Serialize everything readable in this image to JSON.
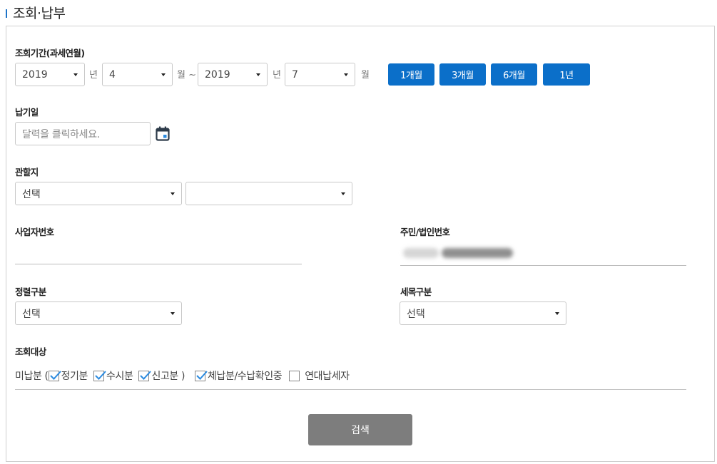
{
  "page": {
    "title": "조회·납부"
  },
  "period": {
    "label": "조회기간(과세연월)",
    "from_year": "2019",
    "year_unit": "년",
    "from_month": "4",
    "month_unit": "월 ~",
    "to_year": "2019",
    "to_month": "7",
    "to_month_unit": "월",
    "buttons": [
      "1개월",
      "3개월",
      "6개월",
      "1년"
    ]
  },
  "due_date": {
    "label": "납기일",
    "placeholder": "달력을 클릭하세요.",
    "icon": "calendar-icon"
  },
  "jurisdiction": {
    "label": "관할지",
    "first_value": "선택",
    "second_value": ""
  },
  "business_number": {
    "label": "사업자번호",
    "value": ""
  },
  "resident_number": {
    "label": "주민/법인번호"
  },
  "assessment_type": {
    "label": "정렬구분",
    "value": "선택"
  },
  "tax_item": {
    "label": "세목구분",
    "value": "선택"
  },
  "target": {
    "label": "조회대상",
    "prefix": "미납분 (",
    "options": [
      {
        "label": "정기분",
        "checked": true
      },
      {
        "label": "수시분",
        "checked": true
      },
      {
        "label": "신고분  )",
        "checked": true
      },
      {
        "label": "체납분/수납확인중",
        "checked": true
      },
      {
        "label": "연대납세자",
        "checked": false
      }
    ]
  },
  "search_button": "검색",
  "colors": {
    "accent": "#0b6fc9",
    "search_button": "#7d7d7d",
    "title_bar": "#1e74c8"
  }
}
